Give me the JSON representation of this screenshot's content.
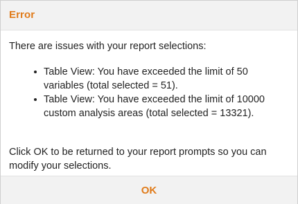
{
  "dialog": {
    "title": "Error",
    "intro": "There are issues with your report selections:",
    "issues": [
      {
        "text": "Table View: You have exceeded the limit of 50 variables (total selected = 51)."
      },
      {
        "text": "Table View: You have exceeded the limit of 10000 custom analysis areas (total selected = 13321)."
      }
    ],
    "footer": "Click OK to be returned to your report prompts so you can modify your selections.",
    "ok_label": "OK"
  },
  "colors": {
    "accent": "#e07b1a",
    "bar_background": "#f2f2f2",
    "text": "#222222"
  }
}
